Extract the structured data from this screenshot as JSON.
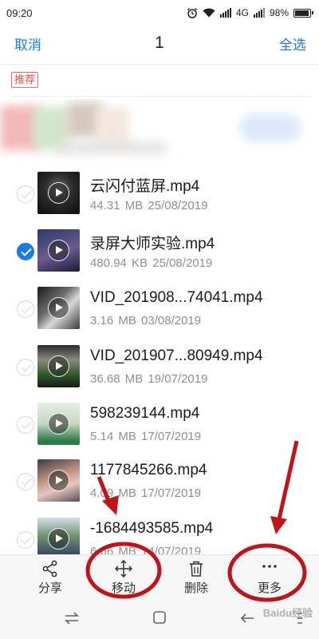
{
  "status_bar": {
    "time": "09:20",
    "network": "4G",
    "battery": "98%",
    "battery_level": 0.98
  },
  "header": {
    "cancel_label": "取消",
    "selected_count": "1",
    "select_all_label": "全选"
  },
  "recommend": {
    "badge": "推荐"
  },
  "files": [
    {
      "name": "云闪付蓝屏.mp4",
      "size": "44.31 MB",
      "date": "25/08/2019",
      "selected": false
    },
    {
      "name": "录屏大师实验.mp4",
      "size": "480.94 KB",
      "date": "25/08/2019",
      "selected": true
    },
    {
      "name": "VID_201908...74041.mp4",
      "size": "3.16 MB",
      "date": "03/08/2019",
      "selected": false
    },
    {
      "name": "VID_201907...80949.mp4",
      "size": "36.68 MB",
      "date": "19/07/2019",
      "selected": false
    },
    {
      "name": "598239144.mp4",
      "size": "5.14 MB",
      "date": "17/07/2019",
      "selected": false
    },
    {
      "name": "1177845266.mp4",
      "size": "4.09 MB",
      "date": "17/07/2019",
      "selected": false
    },
    {
      "name": "-1684493585.mp4",
      "size": "6.66 MB",
      "date": "14/07/2019",
      "selected": false
    }
  ],
  "actions": {
    "share": "分享",
    "move": "移动",
    "delete": "删除",
    "more": "更多"
  },
  "watermark": "Baidu经验",
  "colors": {
    "accent": "#1a7be8",
    "annotation": "#c0141a"
  }
}
